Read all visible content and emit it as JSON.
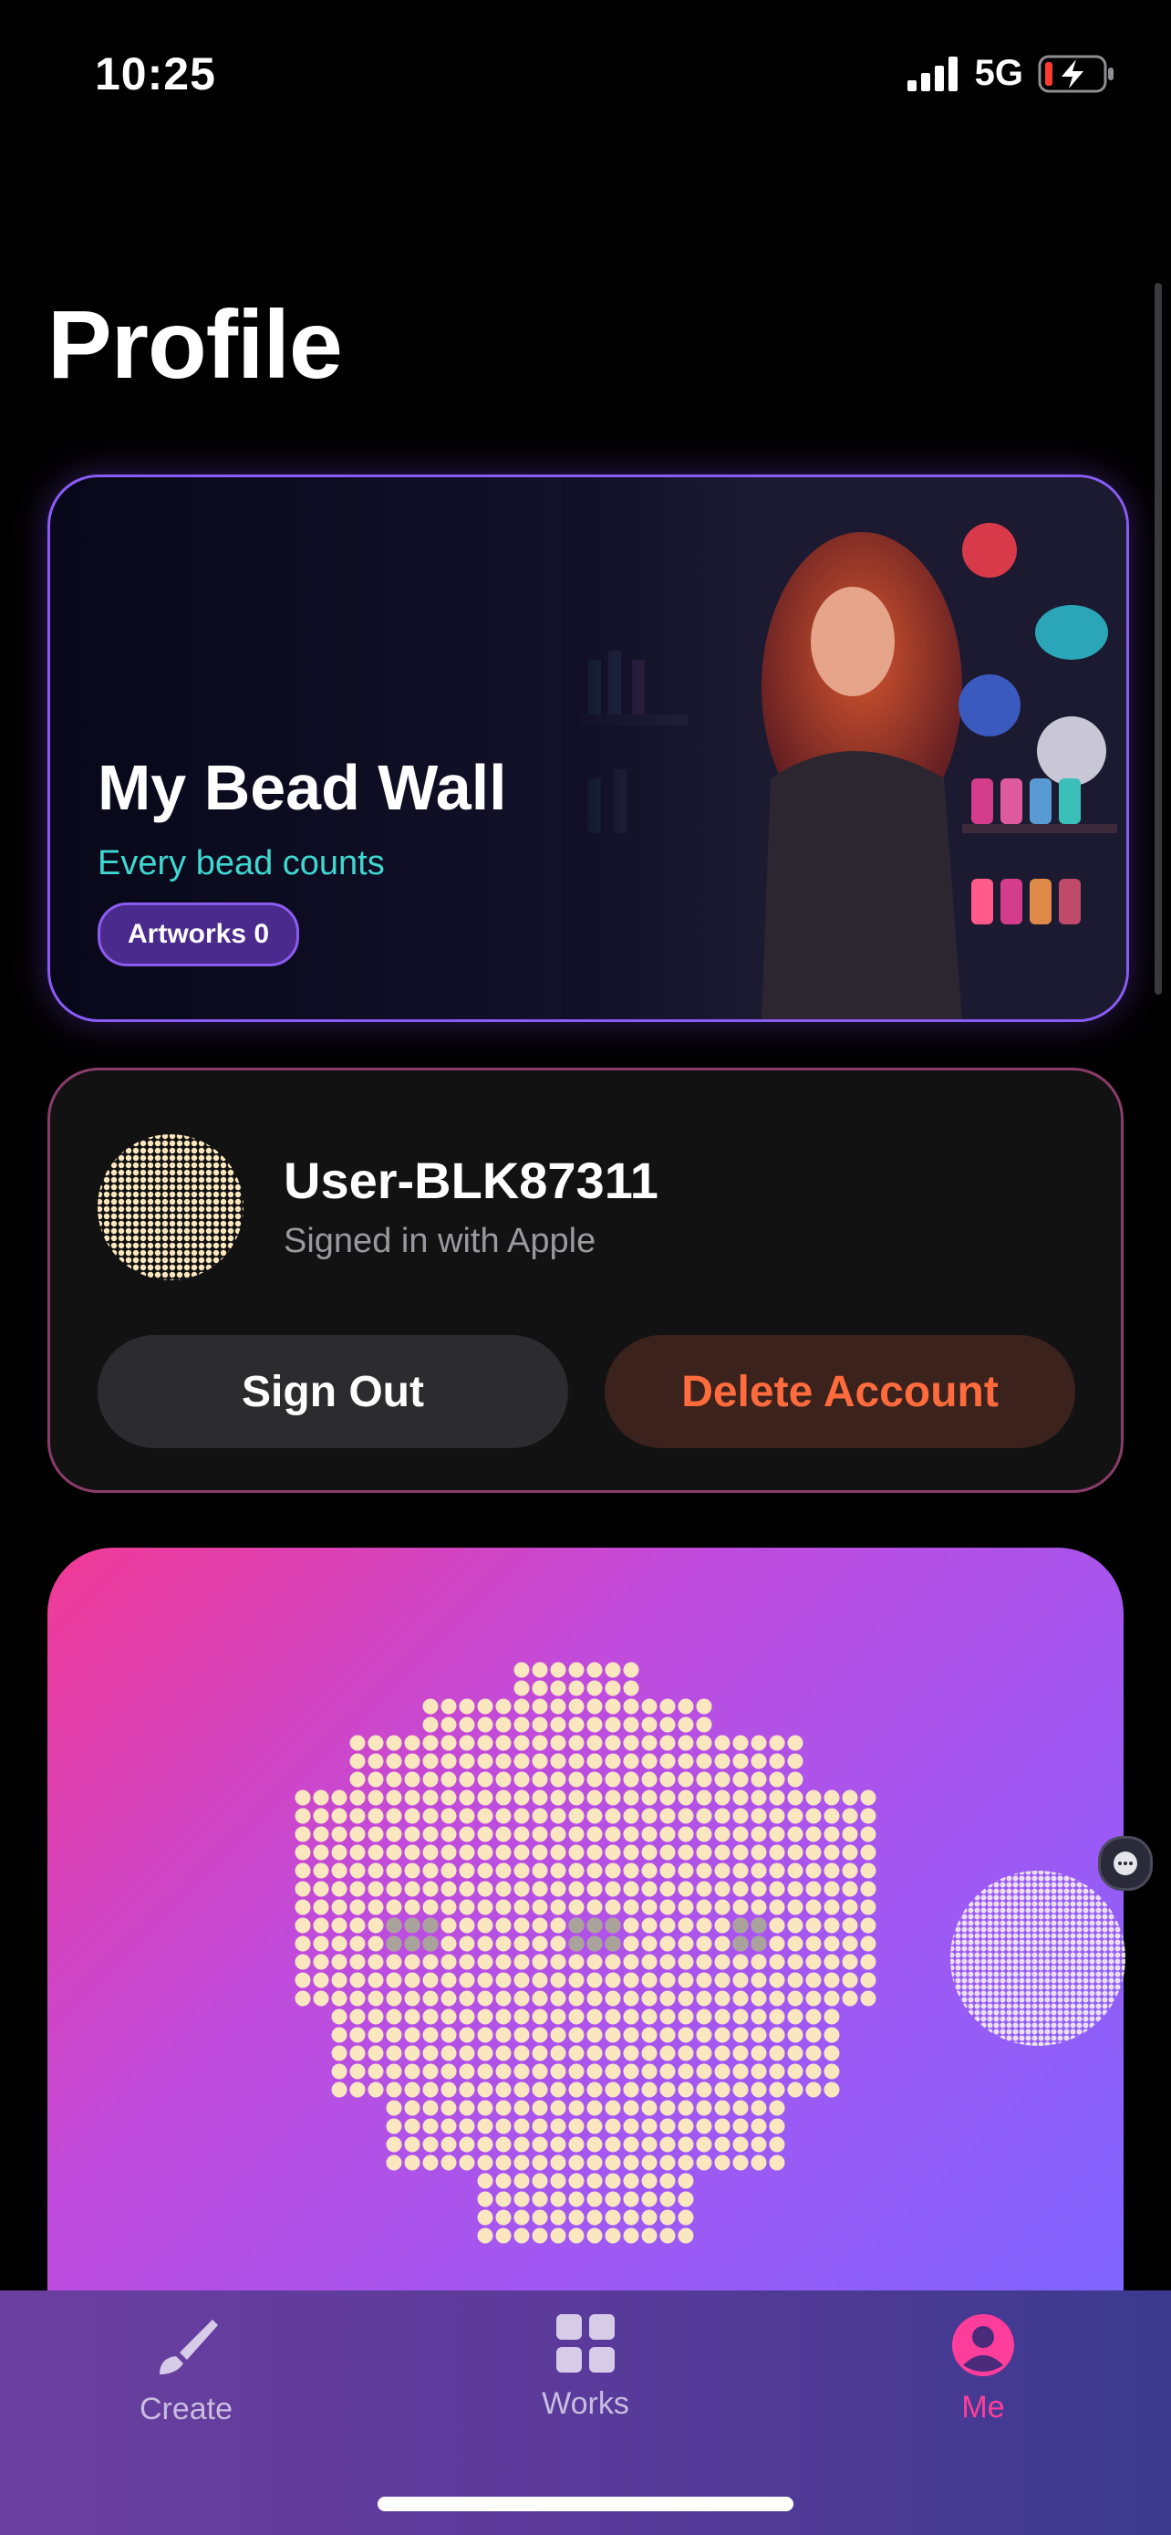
{
  "status": {
    "time": "10:25",
    "network": "5G"
  },
  "page": {
    "title": "Profile"
  },
  "hero": {
    "title": "My Bead Wall",
    "subtitle": "Every bead counts",
    "artworks_label": "Artworks 0"
  },
  "account": {
    "username": "User-BLK87311",
    "signin_method": "Signed in with Apple",
    "sign_out_label": "Sign Out",
    "delete_label": "Delete Account"
  },
  "tabs": [
    {
      "label": "Create",
      "icon": "brush-icon"
    },
    {
      "label": "Works",
      "icon": "grid-icon"
    },
    {
      "label": "Me",
      "icon": "person-icon",
      "active": true
    }
  ],
  "colors": {
    "accent": "#ff3d9a",
    "hero_subtitle": "#3fd7d0",
    "delete": "#ff6b3d",
    "bead": "#fbe7bf"
  }
}
